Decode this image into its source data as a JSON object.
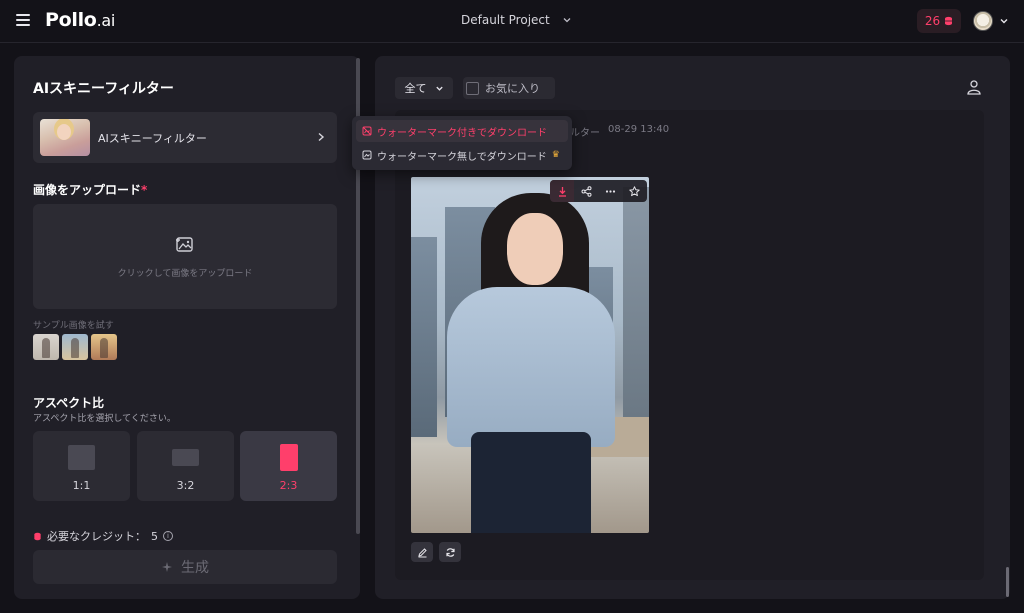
{
  "header": {
    "logo_main": "Pollo",
    "logo_suffix": ".ai",
    "project_name": "Default Project",
    "credits": "26"
  },
  "sidebar": {
    "title": "AIスキニーフィルター",
    "tool_name": "AIスキニーフィルター",
    "upload_label": "画像をアップロード",
    "upload_required_mark": "*",
    "upload_prompt": "クリックして画像をアップロード",
    "sample_label": "サンプル画像を試す",
    "aspect_title": "アスペクト比",
    "aspect_subtitle": "アスペクト比を選択してください。",
    "ratios": [
      {
        "label": "1:1",
        "selected": false
      },
      {
        "label": "3:2",
        "selected": false
      },
      {
        "label": "2:3",
        "selected": true
      }
    ],
    "required_credits_label": "必要なクレジット：",
    "required_credits_value": "5",
    "generate_label": "生成"
  },
  "gallery": {
    "filter_all": "全て",
    "favorites_label": "お気に入り",
    "item_title_partial": "ルター",
    "item_timestamp": "08-29 13:40"
  },
  "download_menu": {
    "with_watermark": "ウォーターマーク付きでダウンロード",
    "without_watermark": "ウォーターマーク無しでダウンロード"
  },
  "colors": {
    "accent": "#ff3f6b",
    "panel": "#201f27",
    "background": "#131218"
  }
}
